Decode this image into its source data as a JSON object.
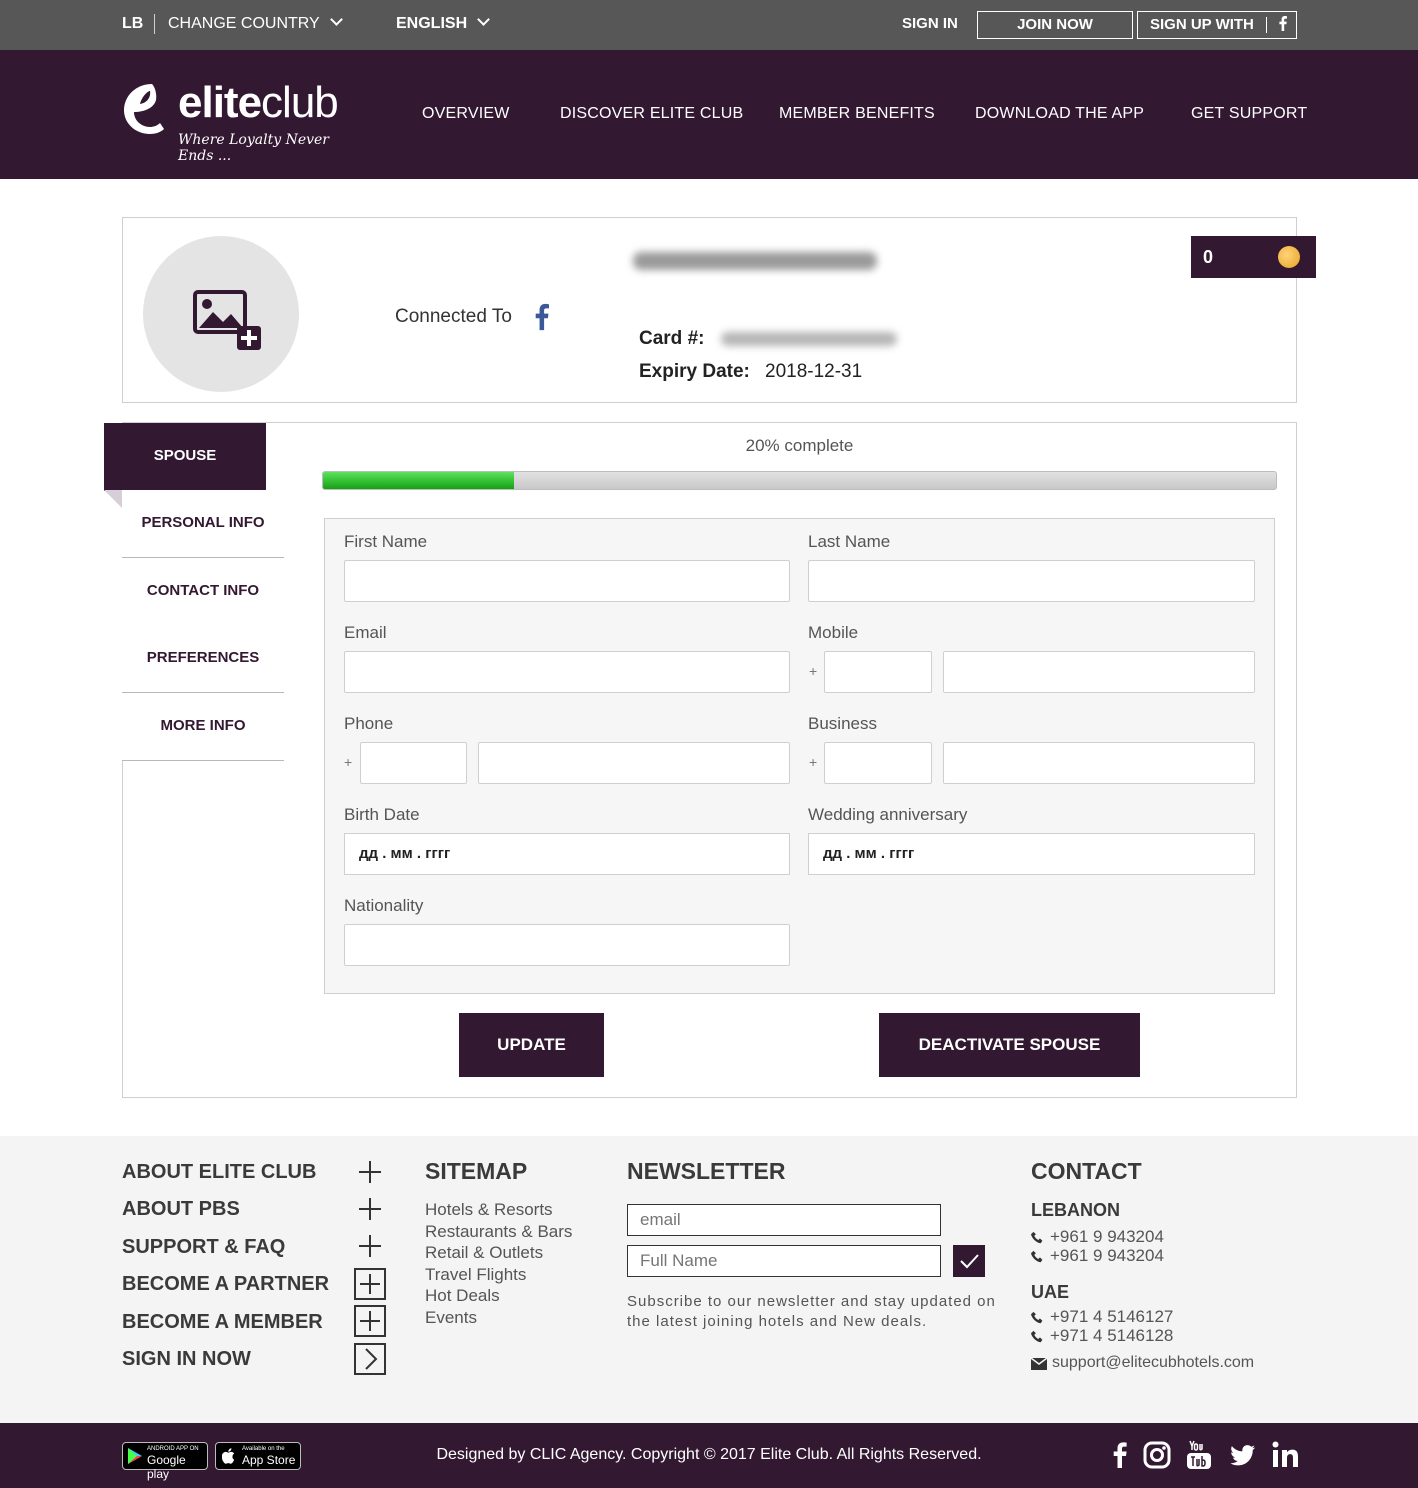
{
  "topbar": {
    "country_code": "LB",
    "change_country": "CHANGE COUNTRY",
    "language": "ENGLISH",
    "sign_in": "SIGN IN",
    "join_now": "JOIN NOW",
    "sign_up_with": "SIGN UP WITH"
  },
  "brand": {
    "name_part1": "elite",
    "name_part2": "club",
    "tagline": "Where Loyalty Never Ends ...",
    "primary_color": "#331831"
  },
  "nav": [
    "OVERVIEW",
    "DISCOVER ELITE CLUB",
    "MEMBER BENEFITS",
    "DOWNLOAD THE APP",
    "GET SUPPORT"
  ],
  "profile": {
    "connected_to": "Connected To",
    "card_label": "Card #:",
    "expiry_label": "Expiry Date:",
    "expiry_value": "2018-12-31",
    "points": "0"
  },
  "tabs": [
    "SPOUSE",
    "PERSONAL INFO",
    "CONTACT INFO",
    "PREFERENCES",
    "MORE INFO"
  ],
  "progress": {
    "label": "20% complete",
    "percent": 20
  },
  "form": {
    "first_name": "First Name",
    "last_name": "Last Name",
    "email": "Email",
    "mobile": "Mobile",
    "phone": "Phone",
    "business": "Business",
    "birth_date": "Birth Date",
    "wedding_anniversary": "Wedding anniversary",
    "nationality": "Nationality",
    "date_placeholder": "дд . мм . гггг",
    "plus": "+"
  },
  "buttons": {
    "update": "UPDATE",
    "deactivate": "DEACTIVATE SPOUSE"
  },
  "footer": {
    "links": [
      "ABOUT ELITE CLUB",
      "ABOUT PBS",
      "SUPPORT & FAQ",
      "BECOME A PARTNER",
      "BECOME A MEMBER",
      "SIGN IN NOW"
    ],
    "sitemap_title": "SITEMAP",
    "sitemap": [
      "Hotels & Resorts",
      "Restaurants & Bars",
      "Retail & Outlets",
      "Travel Flights",
      "Hot Deals",
      "Events"
    ],
    "newsletter_title": "NEWSLETTER",
    "newsletter_email_placeholder": "email",
    "newsletter_name_placeholder": "Full Name",
    "newsletter_text": "Subscribe to our newsletter and stay updated on the latest joining hotels and New deals.",
    "contact_title": "CONTACT",
    "lebanon": "LEBANON",
    "lebanon_phone_1": "+961 9 943204",
    "lebanon_phone_2": "+961 9 943204",
    "uae": "UAE",
    "uae_phone_1": "+971 4 5146127",
    "uae_phone_2": "+971 4 5146128",
    "email": "support@elitecubhotels.com"
  },
  "bottom": {
    "google_small": "ANDROID APP ON",
    "google_big": "Google play",
    "apple_small": "Available on the",
    "apple_big": "App Store",
    "copyright": "Designed by CLIC Agency. Copyright © 2017 Elite Club. All Rights Reserved."
  }
}
